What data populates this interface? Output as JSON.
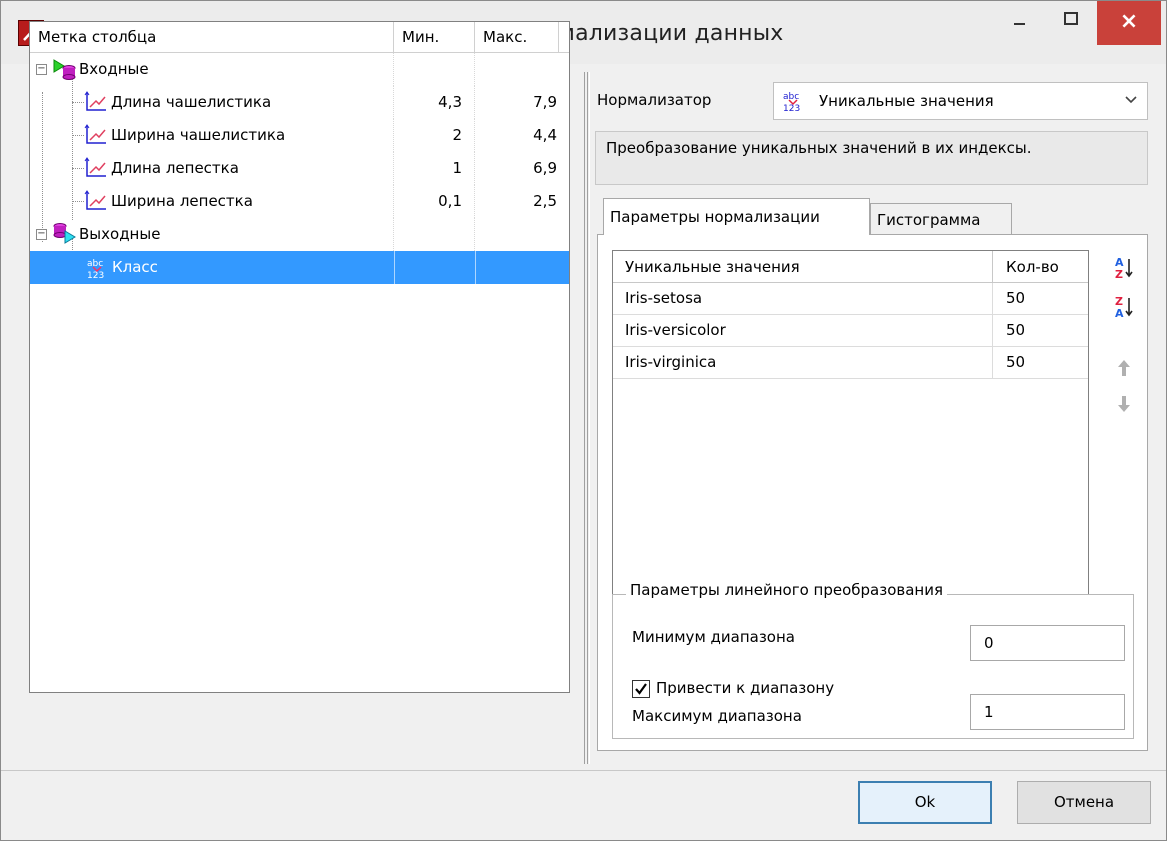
{
  "window": {
    "title": "Настройка нормализации данных",
    "close_label": "×"
  },
  "tree": {
    "headers": {
      "label": "Метка столбца",
      "min": "Мин.",
      "max": "Макс."
    },
    "groups": [
      {
        "label": "Входные",
        "expander": "−",
        "items": [
          {
            "label": "Длина чашелистика",
            "min": "4,3",
            "max": "7,9"
          },
          {
            "label": "Ширина чашелистика",
            "min": "2",
            "max": "4,4"
          },
          {
            "label": "Длина лепестка",
            "min": "1",
            "max": "6,9"
          },
          {
            "label": "Ширина лепестка",
            "min": "0,1",
            "max": "2,5"
          }
        ]
      },
      {
        "label": "Выходные",
        "expander": "−",
        "items": [
          {
            "label": "Класс",
            "min": "",
            "max": "",
            "selected": true
          }
        ]
      }
    ]
  },
  "normalizer": {
    "label": "Нормализатор",
    "value": "Уникальные значения",
    "description": "Преобразование уникальных значений в их индексы."
  },
  "tabs": [
    {
      "label": "Параметры нормализации",
      "active": true
    },
    {
      "label": "Гистограмма",
      "active": false
    }
  ],
  "unique_values": {
    "headers": {
      "value": "Уникальные значения",
      "count": "Кол-во"
    },
    "rows": [
      {
        "value": "Iris-setosa",
        "count": "50"
      },
      {
        "value": "Iris-versicolor",
        "count": "50"
      },
      {
        "value": "Iris-virginica",
        "count": "50"
      }
    ]
  },
  "linear": {
    "group_title": "Параметры линейного преобразования",
    "checkbox_label": "Привести к диапазону",
    "checked": true,
    "min_label": "Минимум диапазона",
    "min_value": "0",
    "max_label": "Максимум диапазона",
    "max_value": "1"
  },
  "buttons": {
    "ok": "Ok",
    "cancel": "Отмена"
  },
  "colors": {
    "selection": "#3399ff",
    "close": "#c9413a",
    "default_button_border": "#3c7fb1"
  }
}
